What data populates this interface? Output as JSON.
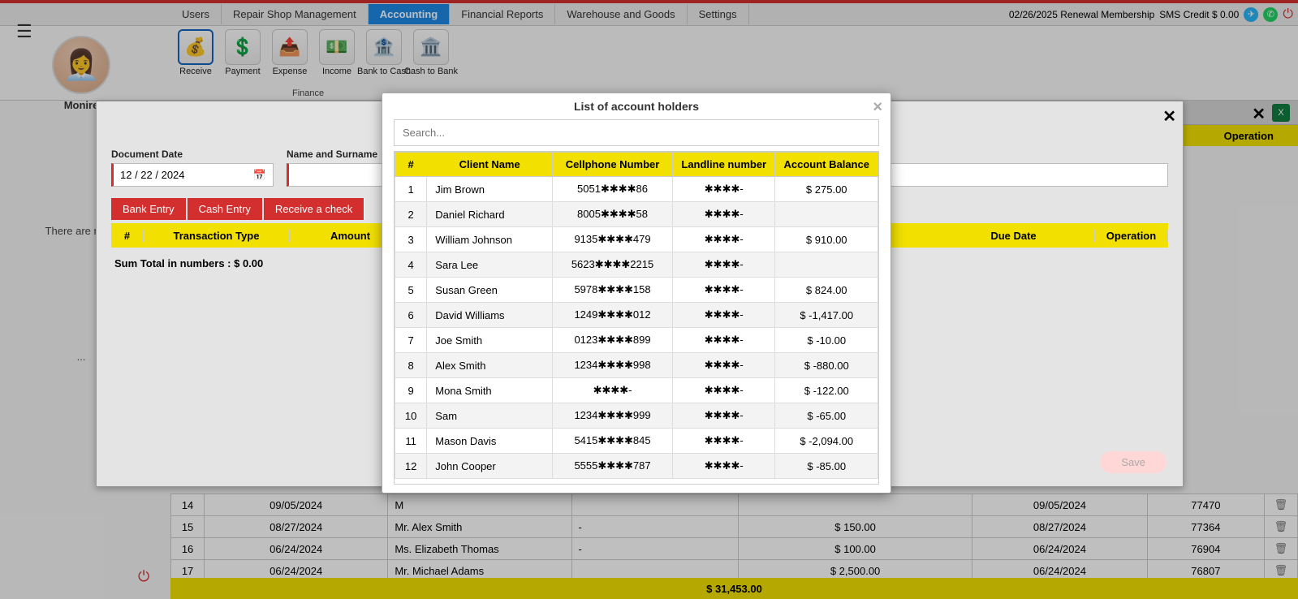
{
  "topnav": {
    "tabs": [
      "Users",
      "Repair Shop Management",
      "Accounting",
      "Financial Reports",
      "Warehouse and Goods",
      "Settings"
    ],
    "active_index": 2,
    "renewal": "02/26/2025 Renewal Membership",
    "sms_credit": "SMS Credit $ 0.00"
  },
  "toolbar": {
    "items": [
      {
        "label": "Receive",
        "icon": "💰",
        "active": true
      },
      {
        "label": "Payment",
        "icon": "💲",
        "active": false
      },
      {
        "label": "Expense",
        "icon": "📤",
        "active": false
      },
      {
        "label": "Income",
        "icon": "💵",
        "active": false
      },
      {
        "label": "Bank to Cash",
        "icon": "🏦",
        "active": false
      },
      {
        "label": "Cash to Bank",
        "icon": "🏛️",
        "active": false
      }
    ],
    "group": "Finance"
  },
  "user": {
    "name": "Monire",
    "left_message": "There are no ...",
    "left_message2": "..."
  },
  "bg": {
    "operation_header": "Operation",
    "rows": [
      {
        "n": "14",
        "date": "09/05/2024",
        "name": "M",
        "col": "",
        "amt": "",
        "date2": "09/05/2024",
        "id": "77470"
      },
      {
        "n": "15",
        "date": "08/27/2024",
        "name": "Mr. Alex Smith",
        "col": "-",
        "amt": "$ 150.00",
        "date2": "08/27/2024",
        "id": "77364"
      },
      {
        "n": "16",
        "date": "06/24/2024",
        "name": "Ms. Elizabeth Thomas",
        "col": "-",
        "amt": "$ 100.00",
        "date2": "06/24/2024",
        "id": "76904"
      },
      {
        "n": "17",
        "date": "06/24/2024",
        "name": "Mr. Michael Adams",
        "col": "",
        "amt": "$ 2,500.00",
        "date2": "06/24/2024",
        "id": "76807"
      }
    ],
    "sum": "$ 31,453.00"
  },
  "entry": {
    "doc_date_label": "Document Date",
    "doc_date_value": "12 / 22 / 2024",
    "name_label": "Name and Surname",
    "buttons": [
      "Bank Entry",
      "Cash Entry",
      "Receive a check"
    ],
    "trans_headers": {
      "num": "#",
      "type": "Transaction Type",
      "amount": "Amount",
      "due": "Due Date",
      "op": "Operation"
    },
    "sum_label": "Sum Total in numbers : $ 0.00",
    "save": "Save"
  },
  "modal": {
    "title": "List of account holders",
    "search_placeholder": "Search...",
    "headers": {
      "num": "#",
      "name": "Client Name",
      "cell": "Cellphone Number",
      "land": "Landline number",
      "bal": "Account Balance"
    },
    "rows": [
      {
        "n": 1,
        "name": "Jim Brown",
        "cell": "5051✱✱✱✱86",
        "land": "✱✱✱✱-",
        "bal": "$ 275.00"
      },
      {
        "n": 2,
        "name": "Daniel Richard",
        "cell": "8005✱✱✱✱58",
        "land": "✱✱✱✱-",
        "bal": ""
      },
      {
        "n": 3,
        "name": "William Johnson",
        "cell": "9135✱✱✱✱479",
        "land": "✱✱✱✱-",
        "bal": "$ 910.00"
      },
      {
        "n": 4,
        "name": "Sara Lee",
        "cell": "5623✱✱✱✱2215",
        "land": "✱✱✱✱-",
        "bal": ""
      },
      {
        "n": 5,
        "name": "Susan Green",
        "cell": "5978✱✱✱✱158",
        "land": "✱✱✱✱-",
        "bal": "$ 824.00"
      },
      {
        "n": 6,
        "name": "David Williams",
        "cell": "1249✱✱✱✱012",
        "land": "✱✱✱✱-",
        "bal": "$ -1,417.00"
      },
      {
        "n": 7,
        "name": "Joe Smith",
        "cell": "0123✱✱✱✱899",
        "land": "✱✱✱✱-",
        "bal": "$ -10.00"
      },
      {
        "n": 8,
        "name": "Alex Smith",
        "cell": "1234✱✱✱✱998",
        "land": "✱✱✱✱-",
        "bal": "$ -880.00"
      },
      {
        "n": 9,
        "name": "Mona Smith",
        "cell": "✱✱✱✱-",
        "land": "✱✱✱✱-",
        "bal": "$ -122.00"
      },
      {
        "n": 10,
        "name": "Sam",
        "cell": "1234✱✱✱✱999",
        "land": "✱✱✱✱-",
        "bal": "$ -65.00"
      },
      {
        "n": 11,
        "name": "Mason Davis",
        "cell": "5415✱✱✱✱845",
        "land": "✱✱✱✱-",
        "bal": "$ -2,094.00"
      },
      {
        "n": 12,
        "name": "John Cooper",
        "cell": "5555✱✱✱✱787",
        "land": "✱✱✱✱-",
        "bal": "$ -85.00"
      }
    ]
  }
}
